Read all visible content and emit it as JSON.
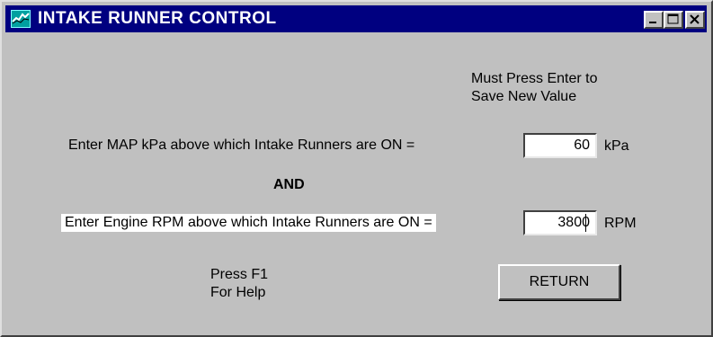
{
  "window": {
    "title": "INTAKE RUNNER CONTROL",
    "icon": "app-wave-icon",
    "controls": [
      "minimize-icon",
      "maximize-icon",
      "close-icon"
    ]
  },
  "notice": {
    "line1": "Must Press Enter to",
    "line2": "Save New Value"
  },
  "map_row": {
    "label": "Enter MAP kPa above which Intake Runners are ON =",
    "value": "60",
    "unit": "kPa"
  },
  "connector": "AND",
  "rpm_row": {
    "label": "Enter Engine RPM above which Intake Runners are ON =",
    "value": "3800",
    "unit": "RPM"
  },
  "help": {
    "line1": "Press F1",
    "line2": "For Help"
  },
  "return_button": "RETURN",
  "colors": {
    "titlebar": "#000080",
    "face": "#c0c0c0",
    "field": "#ffffff"
  }
}
